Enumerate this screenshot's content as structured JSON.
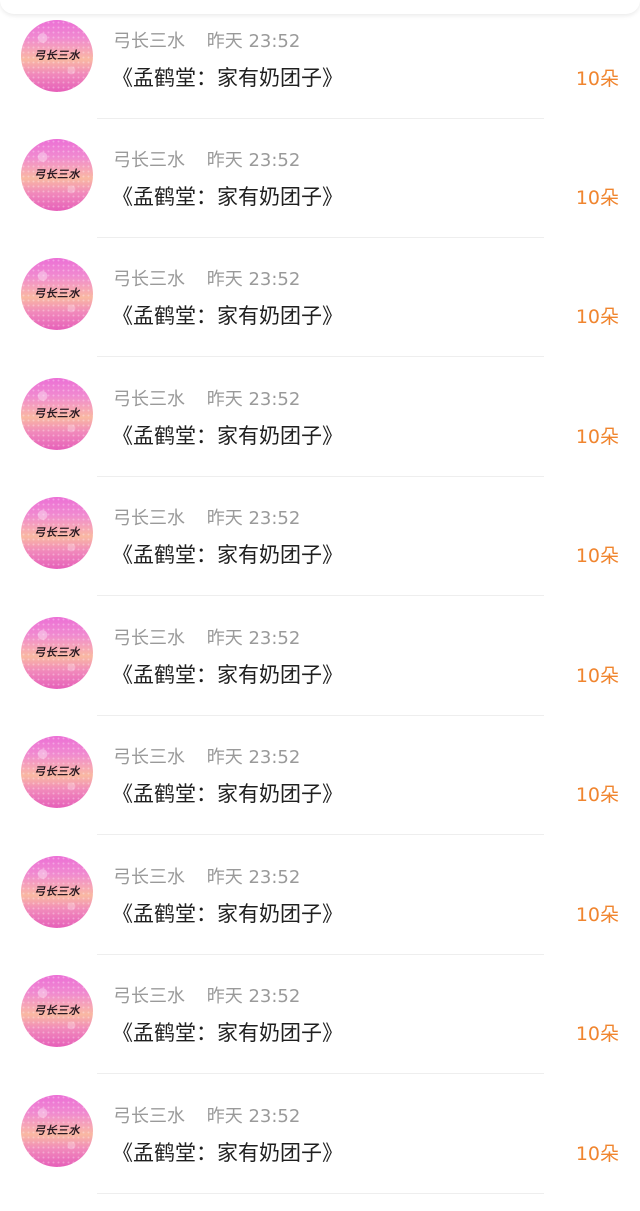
{
  "avatar_logo_text": "弓长三水",
  "colors": {
    "flower_count": "#f0852f",
    "meta_text": "#9a9a9a",
    "title_text": "#1f1f1f"
  },
  "gifts": [
    {
      "author": "弓长三水",
      "time": "昨天 23:52",
      "title": "《孟鹤堂：家有奶团子》",
      "count": "10朵"
    },
    {
      "author": "弓长三水",
      "time": "昨天 23:52",
      "title": "《孟鹤堂：家有奶团子》",
      "count": "10朵"
    },
    {
      "author": "弓长三水",
      "time": "昨天 23:52",
      "title": "《孟鹤堂：家有奶团子》",
      "count": "10朵"
    },
    {
      "author": "弓长三水",
      "time": "昨天 23:52",
      "title": "《孟鹤堂：家有奶团子》",
      "count": "10朵"
    },
    {
      "author": "弓长三水",
      "time": "昨天 23:52",
      "title": "《孟鹤堂：家有奶团子》",
      "count": "10朵"
    },
    {
      "author": "弓长三水",
      "time": "昨天 23:52",
      "title": "《孟鹤堂：家有奶团子》",
      "count": "10朵"
    },
    {
      "author": "弓长三水",
      "time": "昨天 23:52",
      "title": "《孟鹤堂：家有奶团子》",
      "count": "10朵"
    },
    {
      "author": "弓长三水",
      "time": "昨天 23:52",
      "title": "《孟鹤堂：家有奶团子》",
      "count": "10朵"
    },
    {
      "author": "弓长三水",
      "time": "昨天 23:52",
      "title": "《孟鹤堂：家有奶团子》",
      "count": "10朵"
    },
    {
      "author": "弓长三水",
      "time": "昨天 23:52",
      "title": "《孟鹤堂：家有奶团子》",
      "count": "10朵"
    }
  ]
}
